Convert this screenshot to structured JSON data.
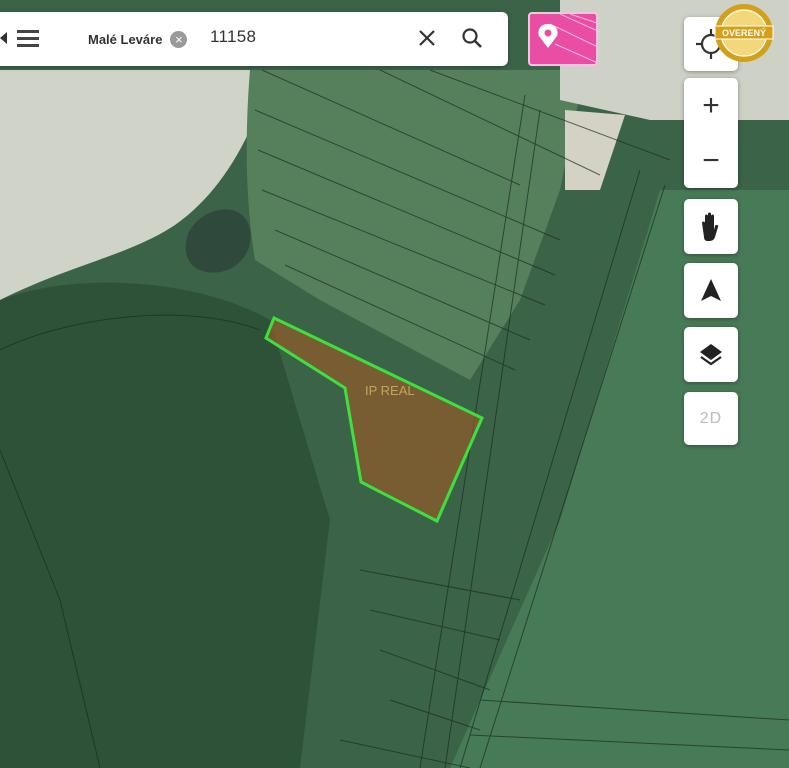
{
  "search": {
    "location_chip": "Malé Leváre",
    "query": "11158"
  },
  "controls": {
    "zoom_in": "+",
    "zoom_out": "−",
    "view_mode": "2D"
  },
  "badge": {
    "text": "OVERENÝ"
  },
  "map": {
    "watermark": "IP REAL"
  },
  "colors": {
    "parcel_outline": "#3de03d",
    "parcel_fill": "#9a5a2a",
    "parcel_button": "#e94ea4",
    "badge_gold": "#d4a017"
  }
}
